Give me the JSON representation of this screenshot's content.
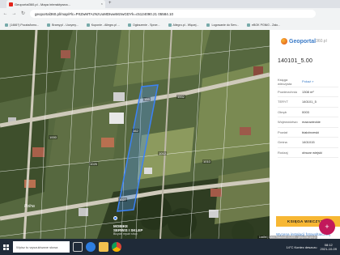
{
  "browser": {
    "tab_title": "Geoportal360.pl - Mapa interaktywna...",
    "tab_close": "×",
    "new_tab": "+",
    "url": "geoportal360.pl/map/#lc=PrtZwMTAzNzUuMDIwwMzIwGDYk=c5124090.21 05584.10",
    "bookmarks": [
      "(1466?) Poczta/lomo...",
      "Bramy.pl - Uczymy...",
      "Kuponie - Allegro.pl ...",
      "Ogłoszenie - Sprze...",
      "Allegro.pl - Więcej...",
      "Logowanie do Serv...",
      "eBOK PGNiG - Zało..."
    ]
  },
  "map": {
    "labels": {
      "plot_a": "159",
      "plot_b": "162",
      "plot_c": "1025",
      "plot_d": "1012",
      "plot_e": "1000",
      "plot_f": "1027",
      "plot_g": "1002",
      "plot_h": "1010",
      "street": "Polna",
      "poi_line1": "MOBIKE",
      "poi_line2": "SERWIS I SKLEP",
      "poi_line3": "Bicycle repair shop"
    }
  },
  "panel": {
    "logo_name": "Geoportal",
    "logo_suffix": "360.pl",
    "plot_id": "140101_5.00",
    "rows": [
      {
        "key": "Księga wieczysta",
        "value": "Pokaż »",
        "link": true
      },
      {
        "key": "Powierzchnia",
        "value": "1308 m²",
        "link": false
      },
      {
        "key": "TERYT",
        "value": "140101_5",
        "link": false
      },
      {
        "key": "Obręb",
        "value": "0003",
        "link": false
      },
      {
        "key": "Województwo",
        "value": "mazowieckie",
        "link": false
      },
      {
        "key": "Powiat",
        "value": "białobrzeski",
        "link": false
      },
      {
        "key": "Gmina",
        "value": "1401015",
        "link": false
      },
      {
        "key": "Rodzaj",
        "value": "obszar wiejski",
        "link": false
      }
    ],
    "buy_button": "KSIĘGA WIECZYSTA",
    "promo_link": "Wycena instalacji fotowoltaicznej",
    "promo_sub": "Green Solar sp. z o.o.",
    "fab_icon": "+",
    "attribution": "Leaflet | Dane Rastrowe GUGiK - geoportal.gov.pl"
  },
  "taskbar": {
    "search_placeholder": "Wpisz tu wyszukiwane słowa",
    "tray_weather": "14°C  Koniec deszczu",
    "time": "08:12",
    "date": "2021-10-09"
  }
}
